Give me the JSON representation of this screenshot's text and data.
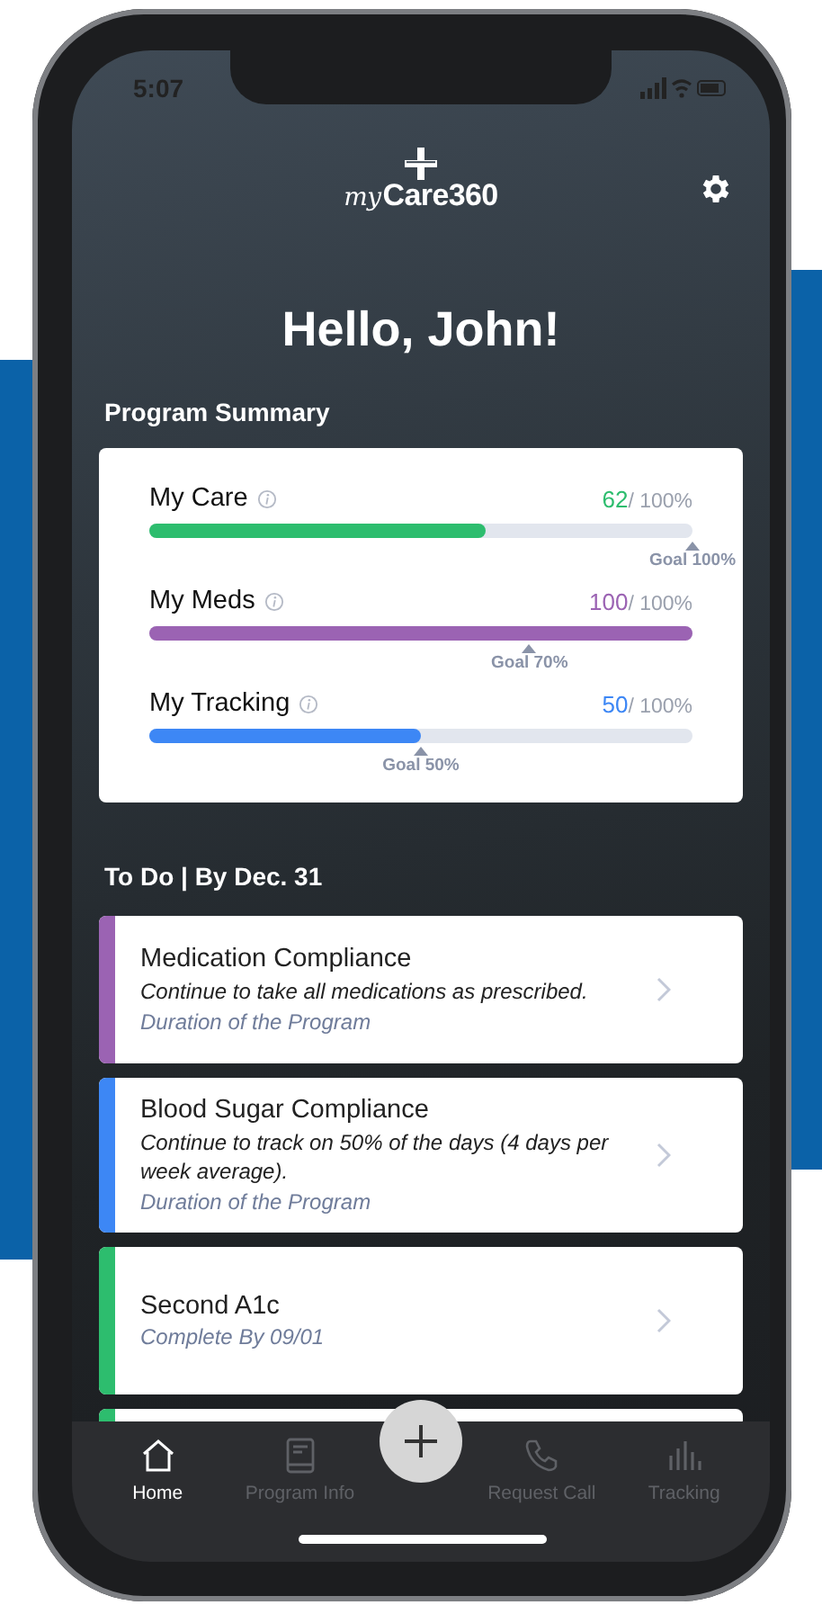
{
  "status_bar": {
    "time": "5:07"
  },
  "header": {
    "logo_script": "my",
    "logo_main": "Care360"
  },
  "greeting": "Hello, John!",
  "program_summary": {
    "title": "Program Summary",
    "metrics": [
      {
        "name": "My Care",
        "value": "62",
        "total": "/ 100%",
        "level": 0.62,
        "color": "#2dbd6e",
        "goal": {
          "label": "Goal 100%",
          "level": 1.0
        }
      },
      {
        "name": "My Meds",
        "value": "100",
        "total": "/ 100%",
        "level": 1.0,
        "color": "#9b63b3",
        "goal": {
          "label": "Goal 70%",
          "level": 0.7
        }
      },
      {
        "name": "My Tracking",
        "value": "50",
        "total": "/ 100%",
        "level": 0.5,
        "color": "#3d87f5",
        "goal": {
          "label": "Goal 50%",
          "level": 0.5
        }
      }
    ]
  },
  "todo": {
    "title": "To Do | By Dec. 31",
    "items": [
      {
        "color": "#9b63b3",
        "title": "Medication Compliance",
        "description": "Continue to take all medications as prescribed.",
        "due": "Duration of the Program"
      },
      {
        "color": "#3d87f5",
        "title": "Blood Sugar Compliance",
        "description": "Continue to track on 50% of the days (4 days per week average).",
        "due": "Duration of the Program"
      },
      {
        "color": "#2dbd6e",
        "title": "Second A1c",
        "due": "Complete By 09/01"
      },
      {
        "color": "#2dbd6e"
      }
    ]
  },
  "nav": {
    "tabs": [
      {
        "kind": "home",
        "label": "Home",
        "selected": true
      },
      {
        "kind": "info",
        "label": "Program Info",
        "selected": false
      },
      {
        "kind": "add"
      },
      {
        "kind": "call",
        "label": "Request Call",
        "selected": false
      },
      {
        "kind": "tracking",
        "label": "Tracking",
        "selected": false
      }
    ]
  }
}
